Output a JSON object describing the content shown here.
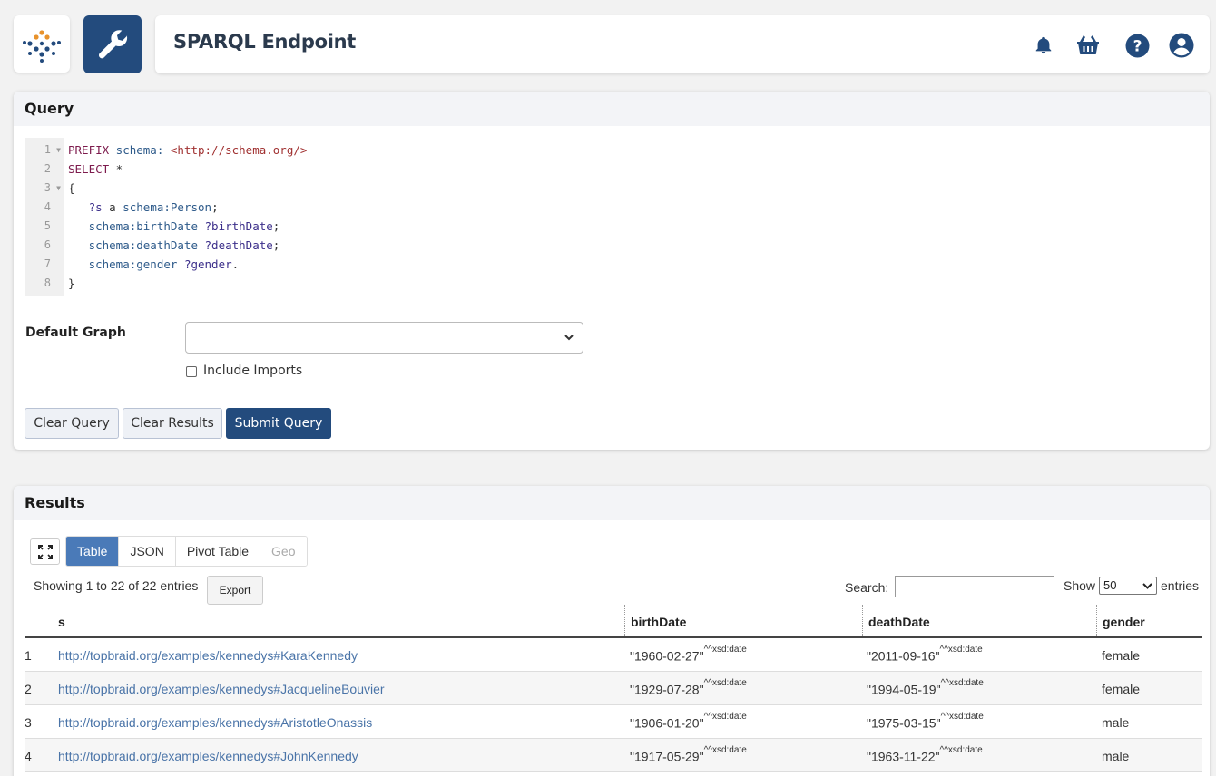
{
  "header": {
    "title": "SPARQL Endpoint"
  },
  "query_panel": {
    "title": "Query",
    "code_lines": [
      {
        "n": "1",
        "fold": true
      },
      {
        "n": "2",
        "fold": false
      },
      {
        "n": "3",
        "fold": true
      },
      {
        "n": "4",
        "fold": false
      },
      {
        "n": "5",
        "fold": false
      },
      {
        "n": "6",
        "fold": false
      },
      {
        "n": "7",
        "fold": false
      },
      {
        "n": "8",
        "fold": false
      }
    ],
    "code": {
      "l1_kw": "PREFIX",
      "l1_prefix": " schema:",
      "l1_iri": " <http://schema.org/>",
      "l2_kw": "SELECT",
      "l2_rest": " *",
      "l3": "{",
      "l4_var": "   ?s",
      "l4_a": " a ",
      "l4_class": "schema:Person",
      "l4_end": ";",
      "l5_prop": "   schema:birthDate",
      "l5_var": " ?birthDate",
      "l5_end": ";",
      "l6_prop": "   schema:deathDate",
      "l6_var": " ?deathDate",
      "l6_end": ";",
      "l7_prop": "   schema:gender",
      "l7_var": " ?gender",
      "l7_end": ".",
      "l8": "}"
    },
    "default_graph_label": "Default Graph",
    "default_graph_value": "",
    "include_imports_label": "Include Imports",
    "include_imports_checked": false,
    "buttons": {
      "clear_query": "Clear Query",
      "clear_results": "Clear Results",
      "submit_query": "Submit Query"
    }
  },
  "results_panel": {
    "title": "Results",
    "tabs": [
      {
        "label": "Table",
        "active": true
      },
      {
        "label": "JSON",
        "active": false
      },
      {
        "label": "Pivot Table",
        "active": false
      },
      {
        "label": "Geo",
        "active": false,
        "disabled": true
      }
    ],
    "showing_text": "Showing 1 to 22 of 22 entries",
    "export_label": "Export",
    "search_label": "Search:",
    "search_value": "",
    "show_label": "Show",
    "show_value": "50",
    "entries_label": "entries",
    "columns": [
      "s",
      "birthDate",
      "deathDate",
      "gender"
    ],
    "rows": [
      {
        "idx": "1",
        "s": "http://topbraid.org/examples/kennedys#KaraKennedy",
        "birth": "\"1960-02-27\"",
        "death": "\"2011-09-16\"",
        "gender": "female"
      },
      {
        "idx": "2",
        "s": "http://topbraid.org/examples/kennedys#JacquelineBouvier",
        "birth": "\"1929-07-28\"",
        "death": "\"1994-05-19\"",
        "gender": "female"
      },
      {
        "idx": "3",
        "s": "http://topbraid.org/examples/kennedys#AristotleOnassis",
        "birth": "\"1906-01-20\"",
        "death": "\"1975-03-15\"",
        "gender": "male"
      },
      {
        "idx": "4",
        "s": "http://topbraid.org/examples/kennedys#JohnKennedy",
        "birth": "\"1917-05-29\"",
        "death": "\"1963-11-22\"",
        "gender": "male"
      }
    ],
    "datatype_suffix": "^^xsd:date"
  },
  "colors": {
    "brand": "#234b7d",
    "tab_active": "#4a7ab8",
    "link": "#4a74a8"
  }
}
